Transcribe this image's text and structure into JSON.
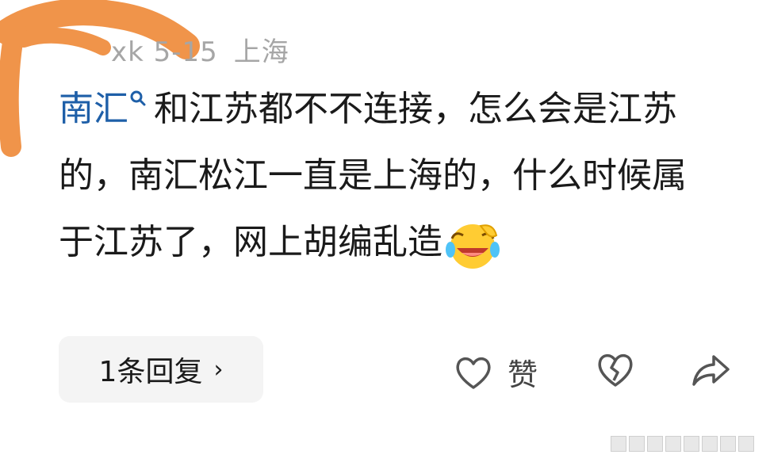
{
  "header": {
    "username_date": "xk 5-15",
    "location": "上海"
  },
  "comment": {
    "link_text": "南汇",
    "body": "和江苏都不不连接，怎么会是江苏的，南汇松江一直是上海的，什么时候属于江苏了，网上胡编乱造"
  },
  "reply": {
    "label": "1条回复",
    "chevron": "›"
  },
  "actions": {
    "like_label": "赞",
    "like_icon": "heart-outline-icon",
    "dislike_icon": "broken-heart-icon",
    "share_icon": "share-arrow-icon"
  },
  "colors": {
    "link": "#1e5fa8",
    "meta": "#a6a6a6",
    "scribble": "#f0944a",
    "reply_bg": "#f4f4f4"
  }
}
